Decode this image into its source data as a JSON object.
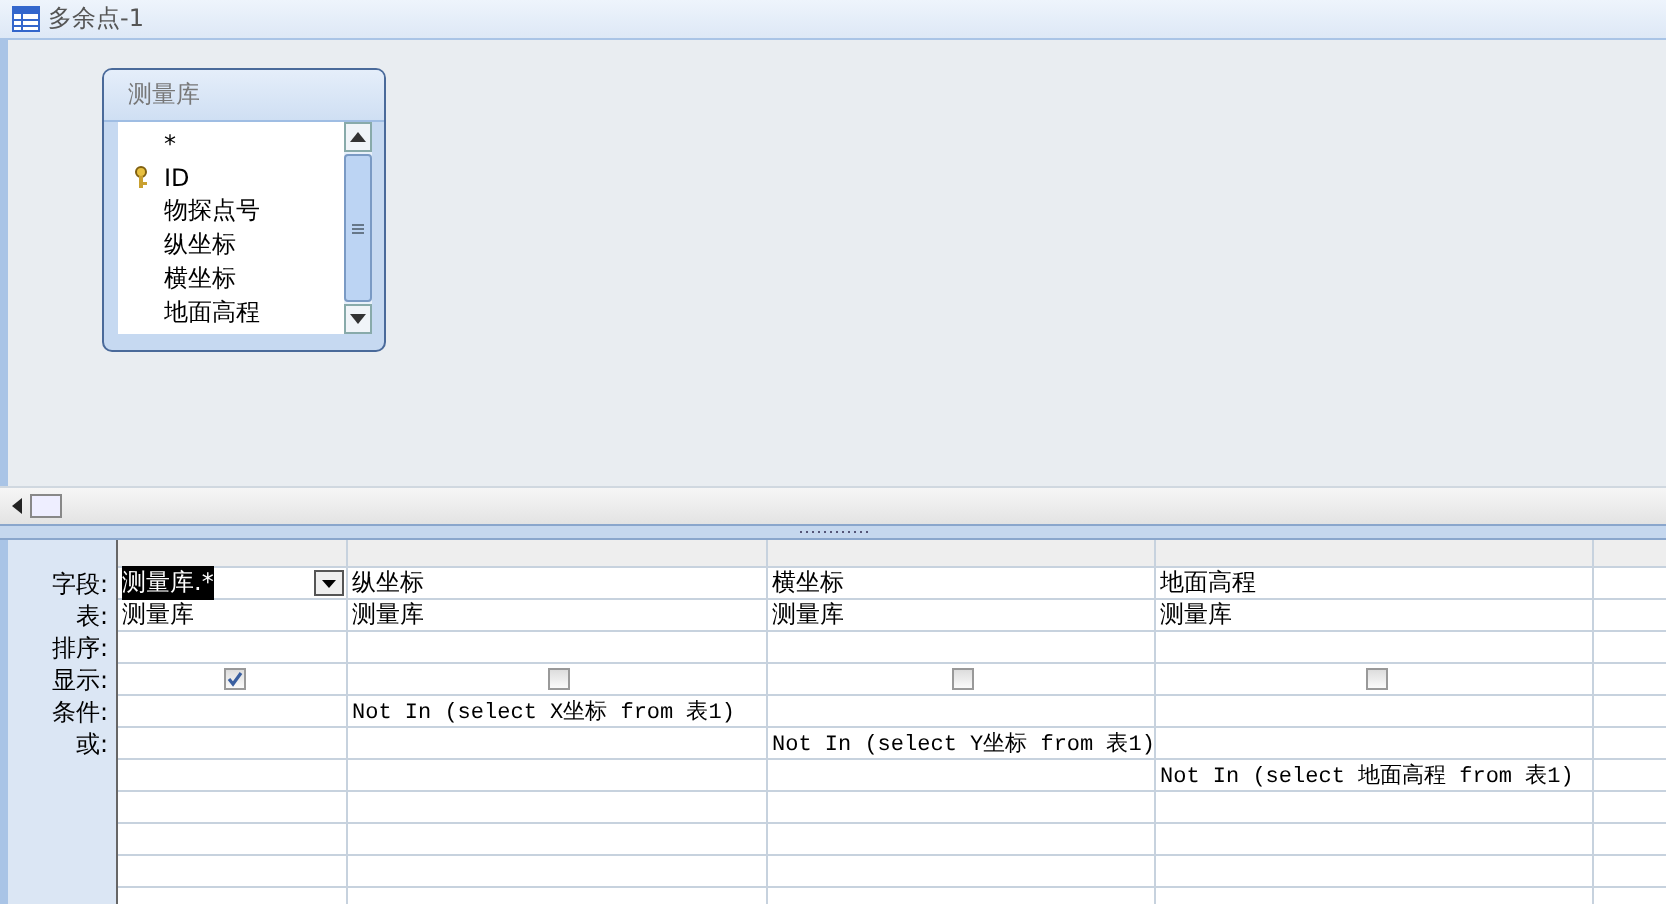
{
  "window": {
    "title": "多余点-1"
  },
  "table_box": {
    "title": "测量库",
    "fields": [
      {
        "name": "*",
        "key": false
      },
      {
        "name": "ID",
        "key": true
      },
      {
        "name": "物探点号",
        "key": false
      },
      {
        "name": "纵坐标",
        "key": false
      },
      {
        "name": "横坐标",
        "key": false
      },
      {
        "name": "地面高程",
        "key": false
      }
    ]
  },
  "grid": {
    "row_labels": [
      "字段:",
      "表:",
      "排序:",
      "显示:",
      "条件:",
      "或:"
    ],
    "columns": [
      {
        "field": "测量库.*",
        "selected": true,
        "table": "测量库",
        "show": true
      },
      {
        "field": "纵坐标",
        "selected": false,
        "table": "测量库",
        "show": false,
        "criteria": "Not In (select X坐标 from 表1)"
      },
      {
        "field": "横坐标",
        "selected": false,
        "table": "测量库",
        "show": false,
        "or": "Not In (select Y坐标 from 表1)"
      },
      {
        "field": "地面高程",
        "selected": false,
        "table": "测量库",
        "show": false,
        "or_2": "Not In (select 地面高程 from 表1)"
      }
    ]
  }
}
